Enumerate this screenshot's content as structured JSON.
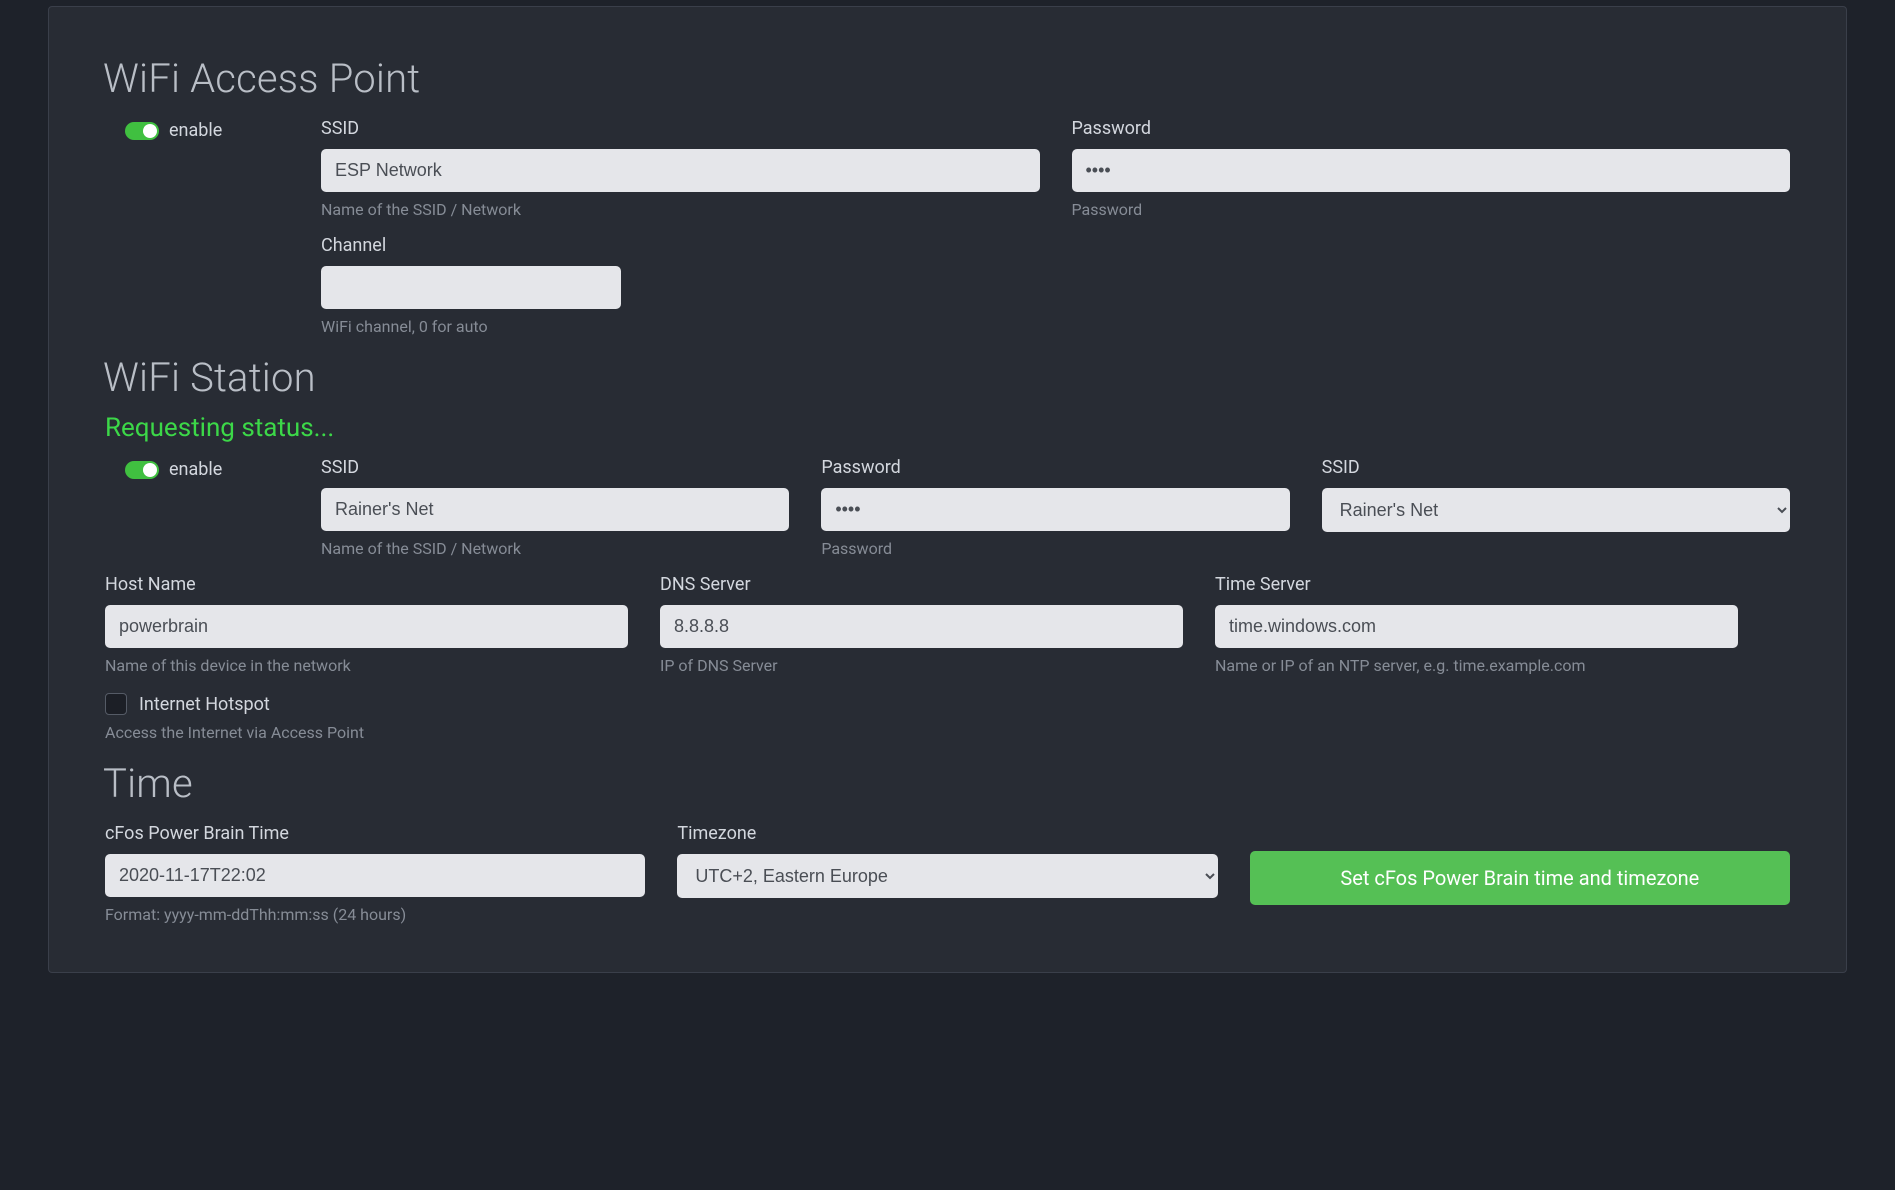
{
  "ap": {
    "heading": "WiFi Access Point",
    "enable_label": "enable",
    "ssid_label": "SSID",
    "ssid_value": "ESP Network",
    "ssid_help": "Name of the SSID / Network",
    "password_label": "Password",
    "password_value": "••••",
    "password_help": "Password",
    "channel_label": "Channel",
    "channel_value": "",
    "channel_help": "WiFi channel, 0 for auto"
  },
  "station": {
    "heading": "WiFi Station",
    "status": "Requesting status...",
    "enable_label": "enable",
    "ssid_label": "SSID",
    "ssid_value": "Rainer's Net",
    "ssid_help": "Name of the SSID / Network",
    "password_label": "Password",
    "password_value": "••••",
    "password_help": "Password",
    "ssid_select_label": "SSID",
    "ssid_select_value": "Rainer's Net",
    "hostname_label": "Host Name",
    "hostname_value": "powerbrain",
    "hostname_help": "Name of this device in the network",
    "dns_label": "DNS Server",
    "dns_value": "8.8.8.8",
    "dns_help": "IP of DNS Server",
    "timeserver_label": "Time Server",
    "timeserver_value": "time.windows.com",
    "timeserver_help": "Name or IP of an NTP server, e.g. time.example.com",
    "hotspot_label": "Internet Hotspot",
    "hotspot_help": "Access the Internet via Access Point"
  },
  "time": {
    "heading": "Time",
    "time_label": "cFos Power Brain Time",
    "time_value": "2020-11-17T22:02",
    "time_help": "Format: yyyy-mm-ddThh:mm:ss (24 hours)",
    "tz_label": "Timezone",
    "tz_value": "UTC+2, Eastern Europe",
    "button": "Set cFos Power Brain time and timezone"
  }
}
